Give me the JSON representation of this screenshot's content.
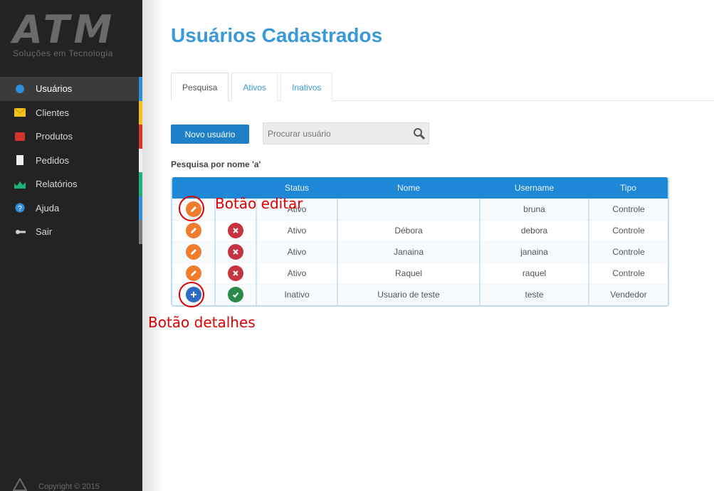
{
  "sidebar": {
    "logo": {
      "mark": "ATM",
      "tagline": "Soluções em Tecnologia"
    },
    "items": [
      {
        "label": "Usuários",
        "icon": "user-icon",
        "color": "#2f8fd8",
        "active": true
      },
      {
        "label": "Clientes",
        "icon": "envelope-icon",
        "color": "#f2c11e",
        "active": false
      },
      {
        "label": "Produtos",
        "icon": "box-icon",
        "color": "#d9342b",
        "active": false
      },
      {
        "label": "Pedidos",
        "icon": "document-icon",
        "color": "#eeeeee",
        "active": false
      },
      {
        "label": "Relatórios",
        "icon": "chart-icon",
        "color": "#1fb07a",
        "active": false
      },
      {
        "label": "Ajuda",
        "icon": "help-icon",
        "color": "#2f8fd8",
        "active": false
      },
      {
        "label": "Sair",
        "icon": "exit-icon",
        "color": "#7a7a7a",
        "active": false
      }
    ],
    "copyright": "Copyright © 2015"
  },
  "page": {
    "title": "Usuários Cadastrados",
    "tabs": [
      {
        "label": "Pesquisa",
        "active": true
      },
      {
        "label": "Ativos",
        "active": false
      },
      {
        "label": "Inativos",
        "active": false
      }
    ],
    "new_button": "Novo usuário",
    "search_placeholder": "Procurar usuário",
    "filter_label": "Pesquisa por nome 'a'"
  },
  "table": {
    "headers": [
      "",
      "",
      "Status",
      "Nome",
      "Username",
      "Tipo"
    ],
    "rows": [
      {
        "action": "edit",
        "status_icon": "none",
        "status": "Ativo",
        "nome": "",
        "username": "bruna",
        "tipo": "Controle"
      },
      {
        "action": "edit",
        "status_icon": "delete",
        "status": "Ativo",
        "nome": "Débora",
        "username": "debora",
        "tipo": "Controle"
      },
      {
        "action": "edit",
        "status_icon": "delete",
        "status": "Ativo",
        "nome": "Janaina",
        "username": "janaina",
        "tipo": "Controle"
      },
      {
        "action": "edit",
        "status_icon": "delete",
        "status": "Ativo",
        "nome": "Raquel",
        "username": "raquel",
        "tipo": "Controle"
      },
      {
        "action": "detail",
        "status_icon": "activate",
        "status": "Inativo",
        "nome": "Usuario de teste",
        "username": "teste",
        "tipo": "Vendedor"
      }
    ]
  },
  "annotations": {
    "edit_label": "Botão editar",
    "detail_label": "Botão detalhes",
    "color": "#e00000"
  }
}
